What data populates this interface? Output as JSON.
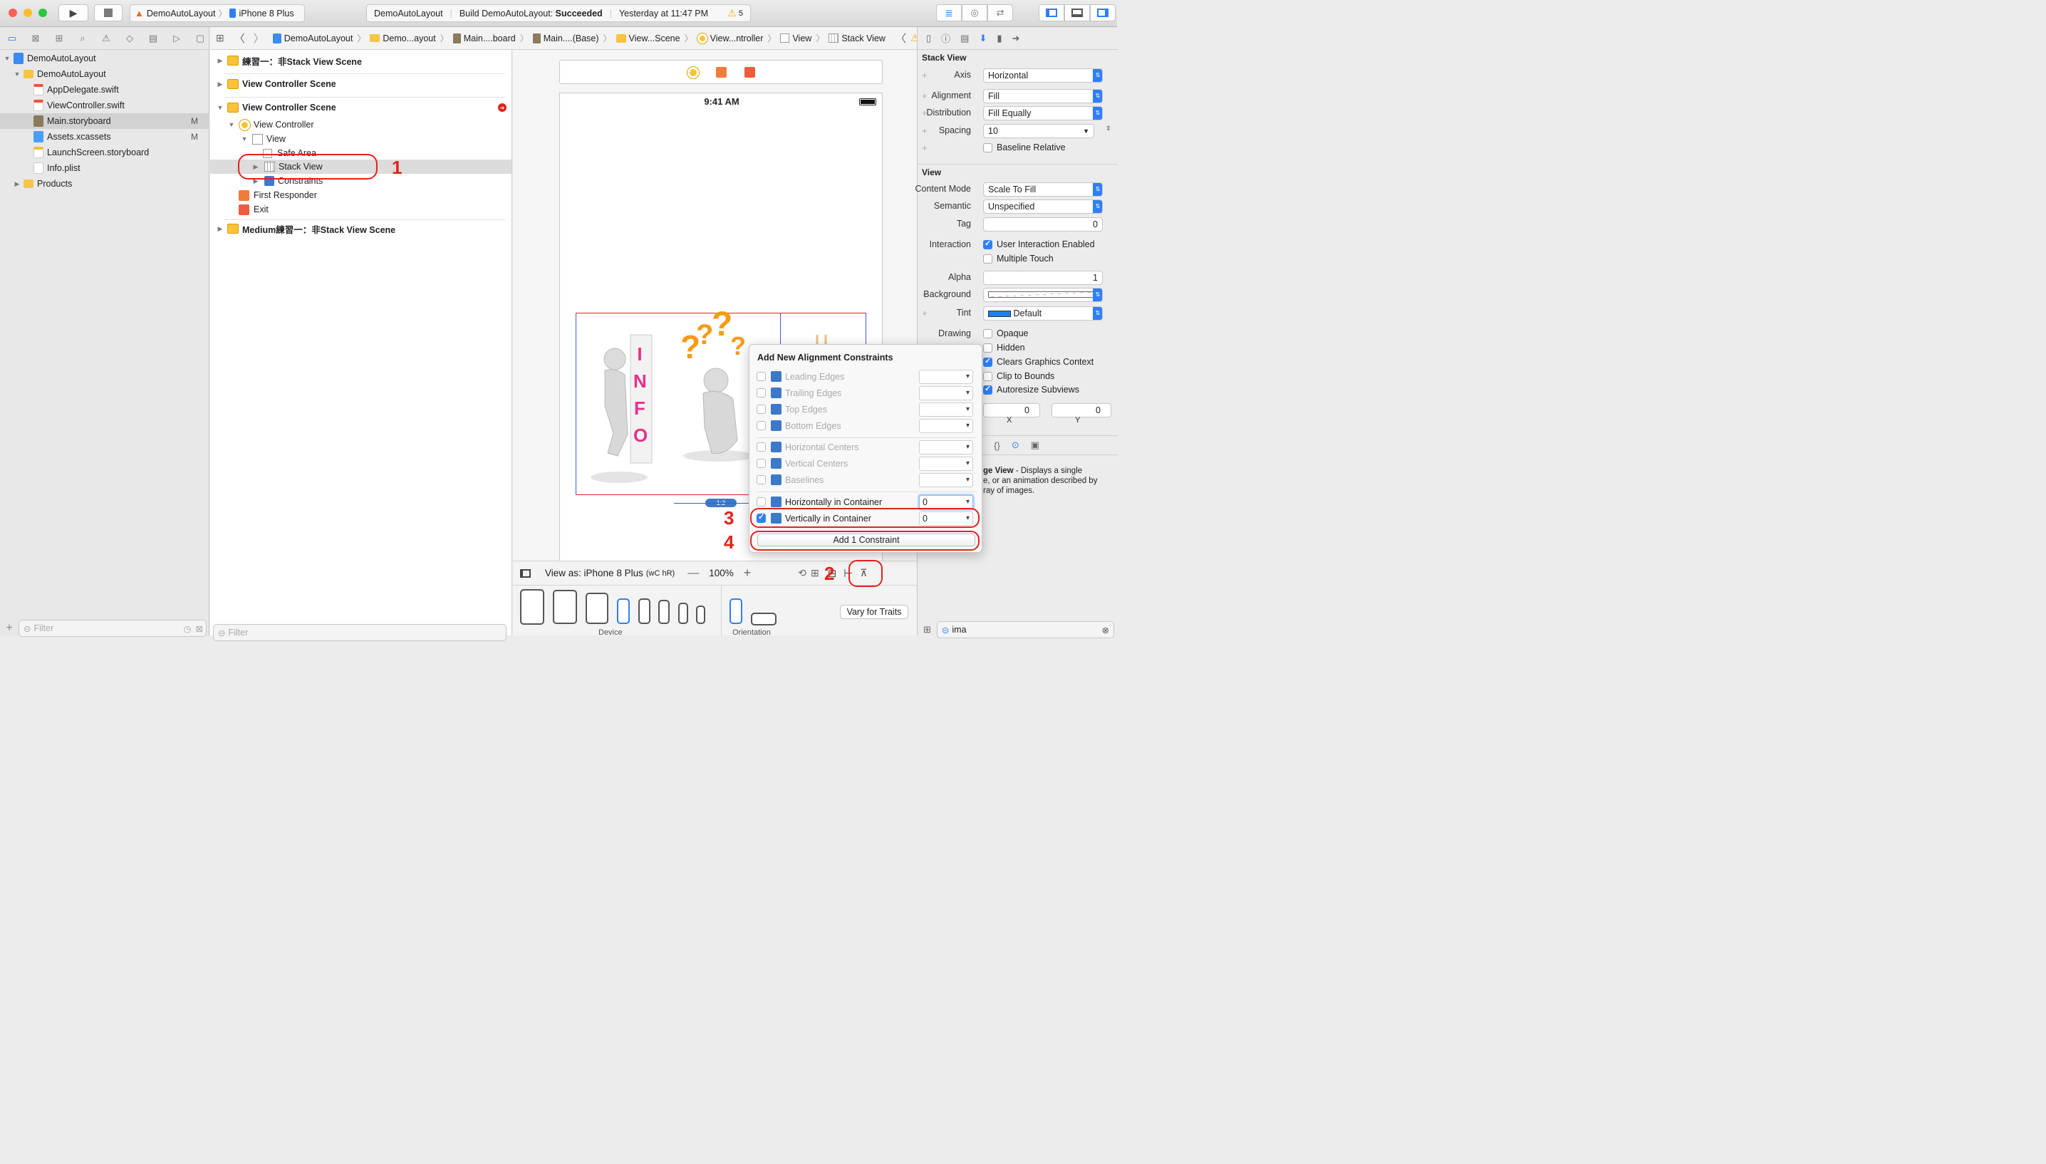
{
  "window": {
    "scheme": "DemoAutoLayout",
    "device": "iPhone 8 Plus",
    "status": {
      "project": "DemoAutoLayout",
      "build_prefix": "Build DemoAutoLayout:",
      "build_result": "Succeeded",
      "time": "Yesterday at 11:47 PM",
      "warning_count": "5"
    }
  },
  "navigator": {
    "items": [
      {
        "label": "DemoAutoLayout",
        "badge": ""
      },
      {
        "label": "DemoAutoLayout",
        "badge": ""
      },
      {
        "label": "AppDelegate.swift",
        "badge": ""
      },
      {
        "label": "ViewController.swift",
        "badge": ""
      },
      {
        "label": "Main.storyboard",
        "badge": "M"
      },
      {
        "label": "Assets.xcassets",
        "badge": "M"
      },
      {
        "label": "LaunchScreen.storyboard",
        "badge": ""
      },
      {
        "label": "Info.plist",
        "badge": ""
      },
      {
        "label": "Products",
        "badge": ""
      }
    ],
    "filter_placeholder": "Filter"
  },
  "jumpbar": {
    "crumbs": [
      "DemoAutoLayout",
      "Demo...ayout",
      "Main....board",
      "Main....(Base)",
      "View...Scene",
      "View...ntroller",
      "View",
      "Stack View"
    ]
  },
  "outline": {
    "rows": [
      "練習一：非Stack View Scene",
      "View Controller Scene",
      "View Controller Scene",
      "View Controller",
      "View",
      "Safe Area",
      "Stack View",
      "Constraints",
      "First Responder",
      "Exit",
      "Medium練習一：非Stack View Scene"
    ],
    "filter_placeholder": "Filter"
  },
  "canvas": {
    "status_time": "9:41 AM",
    "ratio_badge": "1:2",
    "view_as": "View as: iPhone 8 Plus",
    "size_class": "(wC hR)",
    "zoom": "100%",
    "device_label": "Device",
    "orientation_label": "Orientation",
    "vary_for_traits": "Vary for Traits",
    "info_letters": "INFO"
  },
  "popover": {
    "title": "Add New Alignment Constraints",
    "rows": [
      {
        "label": "Leading Edges",
        "value": "",
        "checked": false,
        "enabled": false
      },
      {
        "label": "Trailing Edges",
        "value": "",
        "checked": false,
        "enabled": false
      },
      {
        "label": "Top Edges",
        "value": "",
        "checked": false,
        "enabled": false
      },
      {
        "label": "Bottom Edges",
        "value": "",
        "checked": false,
        "enabled": false
      },
      {
        "label": "Horizontal Centers",
        "value": "",
        "checked": false,
        "enabled": false
      },
      {
        "label": "Vertical Centers",
        "value": "",
        "checked": false,
        "enabled": false
      },
      {
        "label": "Baselines",
        "value": "",
        "checked": false,
        "enabled": false
      },
      {
        "label": "Horizontally in Container",
        "value": "0",
        "checked": false,
        "enabled": true
      },
      {
        "label": "Vertically in Container",
        "value": "0",
        "checked": true,
        "enabled": true
      }
    ],
    "add_button": "Add 1 Constraint"
  },
  "annotations": [
    "1",
    "2",
    "3",
    "4"
  ],
  "inspector": {
    "stack_view_header": "Stack View",
    "axis_label": "Axis",
    "axis_value": "Horizontal",
    "alignment_label": "Alignment",
    "alignment_value": "Fill",
    "distribution_label": "Distribution",
    "distribution_value": "Fill Equally",
    "spacing_label": "Spacing",
    "spacing_value": "10",
    "baseline_relative": "Baseline Relative",
    "view_header": "View",
    "content_mode_label": "Content Mode",
    "content_mode_value": "Scale To Fill",
    "semantic_label": "Semantic",
    "semantic_value": "Unspecified",
    "tag_label": "Tag",
    "tag_value": "0",
    "interaction_label": "Interaction",
    "user_interaction": "User Interaction Enabled",
    "multiple_touch": "Multiple Touch",
    "alpha_label": "Alpha",
    "alpha_value": "1",
    "background_label": "Background",
    "tint_label": "Tint",
    "tint_value": "Default",
    "drawing_label": "Drawing",
    "opaque": "Opaque",
    "hidden": "Hidden",
    "clears_graphics": "Clears Graphics Context",
    "clip_to_bounds": "Clip to Bounds",
    "autoresize": "Autoresize Subviews",
    "x_value": "0",
    "y_value": "0",
    "x_label": "X",
    "y_label": "Y",
    "library_title": "ge View",
    "library_desc": "- Displays a single",
    "library_desc2": "e, or an animation described by",
    "library_desc3": "ray of images.",
    "library_filter": "ima"
  },
  "colors": {
    "accent": "#2f7ff7",
    "annotation": "#e2231a",
    "scene_icon": "#fbc23b"
  }
}
